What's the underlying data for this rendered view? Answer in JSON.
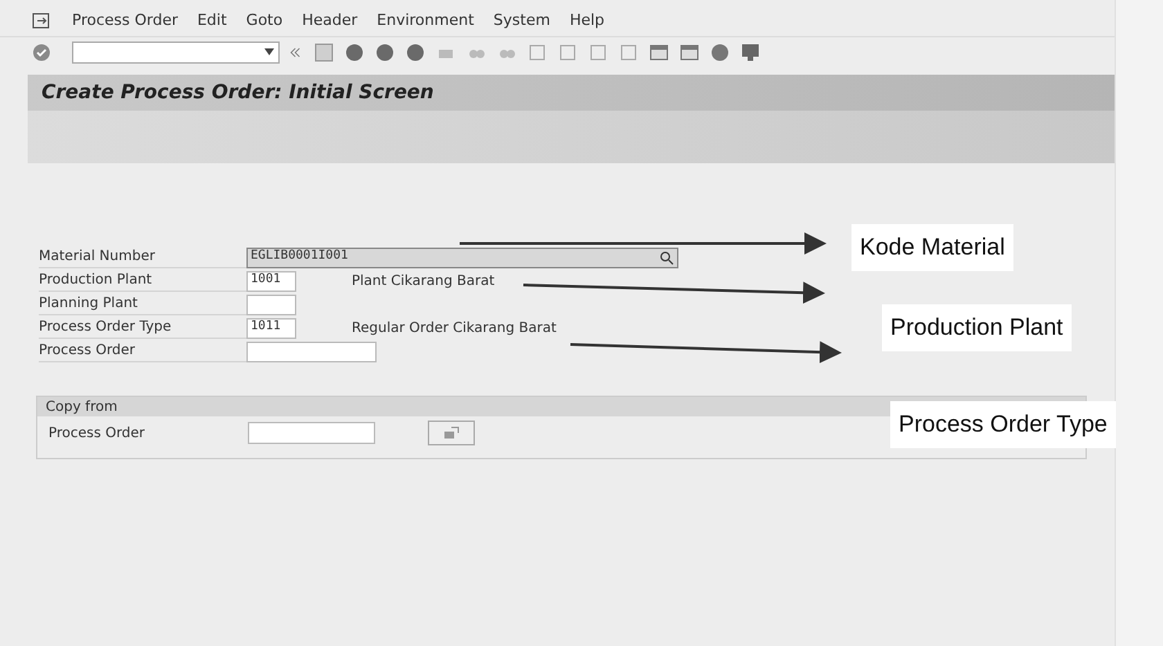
{
  "menu": [
    "Process Order",
    "Edit",
    "Goto",
    "Header",
    "Environment",
    "System",
    "Help"
  ],
  "title": "Create Process Order: Initial Screen",
  "fields": [
    {
      "label": "Material Number",
      "value": "EGLIB0001I001",
      "kind": "search",
      "selected": true
    },
    {
      "label": "Production Plant",
      "value": "1001",
      "kind": "short",
      "description": "Plant Cikarang Barat",
      "selected": false
    },
    {
      "label": "Planning Plant",
      "kind": "short",
      "selected": false
    },
    {
      "label": "Process Order Type",
      "value": "1011",
      "kind": "short",
      "description": "Regular Order Cikarang Barat",
      "selected": false
    },
    {
      "label": "Process Order",
      "kind": "medium",
      "selected": false
    }
  ],
  "copy_from": {
    "title": "Copy from",
    "label": "Process Order"
  },
  "callouts": [
    "Kode Material",
    "Production Plant",
    "Process Order Type"
  ]
}
